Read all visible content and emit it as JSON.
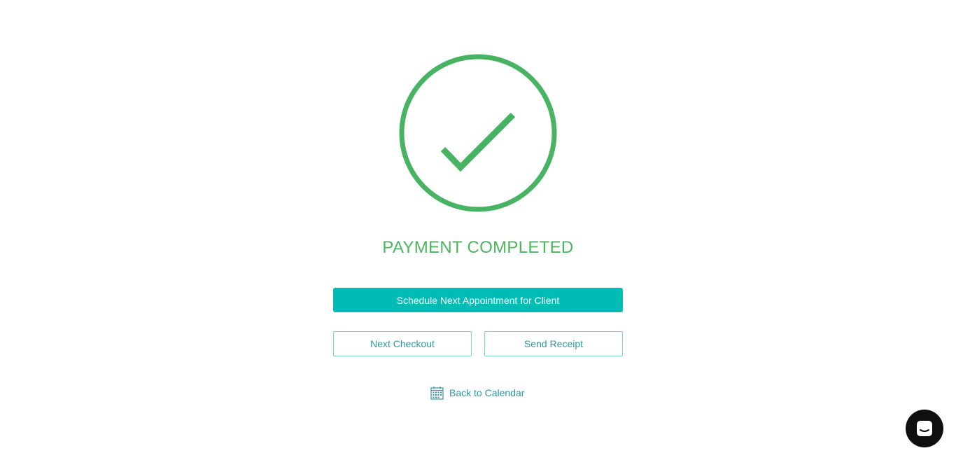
{
  "status": {
    "title": "PAYMENT COMPLETED",
    "icon": "checkmark-circle-icon",
    "color": "#4cb560"
  },
  "actions": {
    "primary_label": "Schedule Next Appointment for Client",
    "next_checkout_label": "Next Checkout",
    "send_receipt_label": "Send Receipt",
    "back_label": "Back to Calendar",
    "back_icon": "calendar-icon"
  },
  "chat": {
    "icon": "chat-icon"
  },
  "colors": {
    "accent": "#00bcb4",
    "link": "#2a9aa2",
    "success": "#4cb560"
  }
}
